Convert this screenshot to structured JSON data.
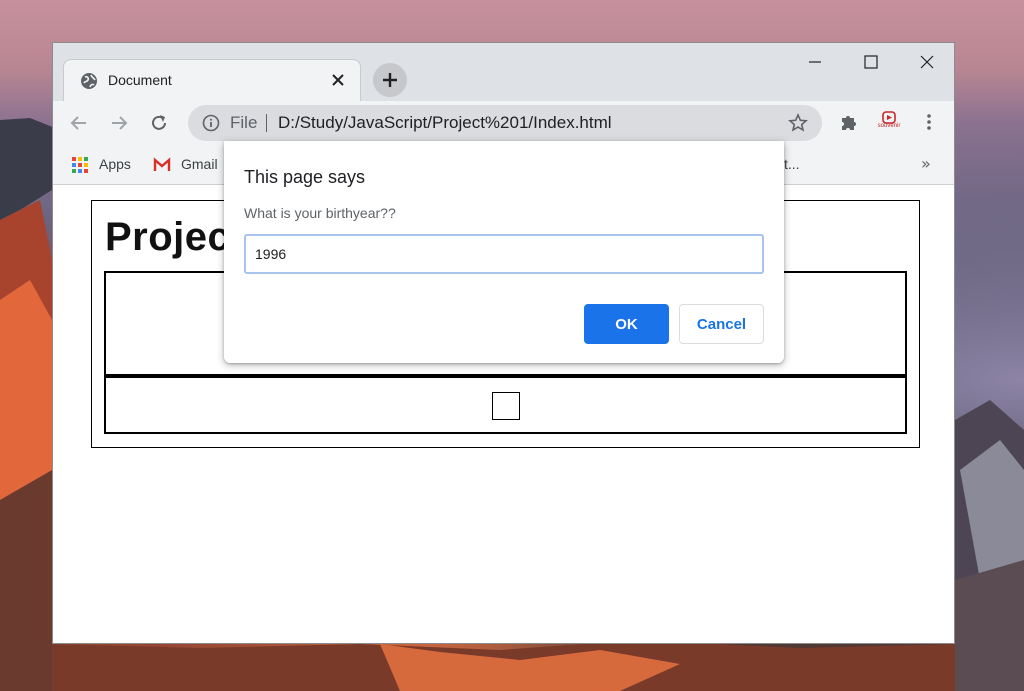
{
  "browser": {
    "tab": {
      "title": "Document",
      "favicon": "globe-icon",
      "close_icon": "close-icon"
    },
    "new_tab_icon": "plus-icon",
    "window_controls": [
      "minimize-icon",
      "maximize-icon",
      "close-icon"
    ],
    "address_bar": {
      "scheme_label": "File",
      "url": "D:/Study/JavaScript/Project%201/Index.html"
    },
    "bookmarks": [
      {
        "label": "Apps",
        "icon": "apps-grid-icon"
      },
      {
        "label": "Gmail",
        "icon": "gmail-icon"
      }
    ],
    "bookmarks_partial_text": "t...",
    "bookmarks_overflow": "»",
    "extensions": {
      "souvenir_label": "souvenir"
    }
  },
  "page": {
    "heading": "Project"
  },
  "dialog": {
    "title": "This page says",
    "message": "What is your birthyear??",
    "input_value": "1996",
    "ok_label": "OK",
    "cancel_label": "Cancel"
  },
  "colors": {
    "accent": "#1a73e8",
    "input_focus": "#a7c3ee",
    "tabstrip": "#dee1e6",
    "toolbar": "#f1f3f4"
  }
}
